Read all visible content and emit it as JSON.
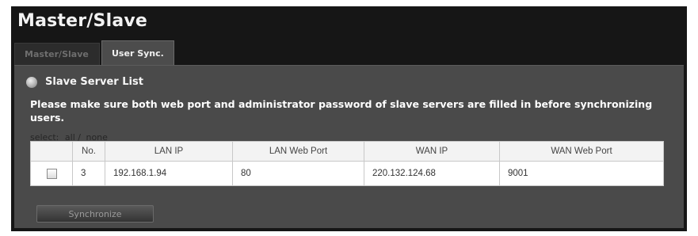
{
  "page": {
    "title": "Master/Slave"
  },
  "tabs": [
    {
      "label": "Master/Slave",
      "active": false
    },
    {
      "label": "User Sync.",
      "active": true
    }
  ],
  "section": {
    "title": "Slave Server List",
    "icon": "bullet-icon",
    "notice": "Please make sure both web port and administrator password of slave servers are filled in before synchronizing users."
  },
  "select": {
    "label": "select:",
    "all": "all",
    "separator": "/",
    "none": "none"
  },
  "table": {
    "columns": [
      "",
      "No.",
      "LAN IP",
      "LAN Web Port",
      "WAN IP",
      "WAN Web Port"
    ],
    "rows": [
      {
        "checked": false,
        "no": "3",
        "lan_ip": "192.168.1.94",
        "lan_web_port": "80",
        "wan_ip": "220.132.124.68",
        "wan_web_port": "9001"
      }
    ]
  },
  "actions": {
    "synchronize_label": "Synchronize"
  },
  "colors": {
    "frame_bg": "#161616",
    "panel_bg": "#4a4a4a",
    "active_tab_bg": "#4c4c4c",
    "table_bg": "#ffffff"
  }
}
